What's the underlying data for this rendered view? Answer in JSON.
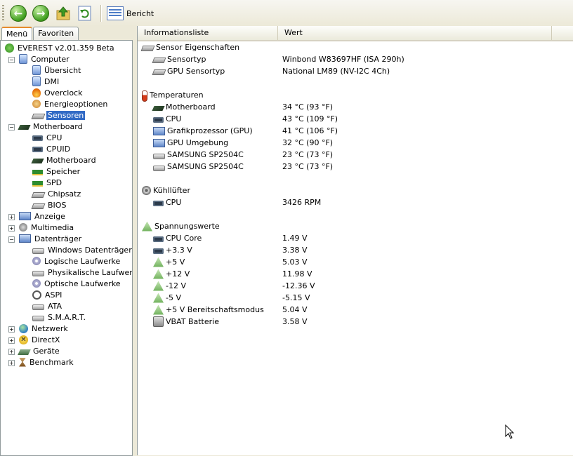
{
  "toolbar": {
    "report_label": "Bericht"
  },
  "tabs": [
    {
      "label": "Menü"
    },
    {
      "label": "Favoriten"
    }
  ],
  "tree": {
    "root": "EVEREST v2.01.359 Beta",
    "items": [
      {
        "label": "Computer"
      },
      {
        "label": "Übersicht"
      },
      {
        "label": "DMI"
      },
      {
        "label": "Overclock"
      },
      {
        "label": "Energieoptionen"
      },
      {
        "label": "Sensoren"
      },
      {
        "label": "Motherboard"
      },
      {
        "label": "CPU"
      },
      {
        "label": "CPUID"
      },
      {
        "label": "Motherboard"
      },
      {
        "label": "Speicher"
      },
      {
        "label": "SPD"
      },
      {
        "label": "Chipsatz"
      },
      {
        "label": "BIOS"
      },
      {
        "label": "Anzeige"
      },
      {
        "label": "Multimedia"
      },
      {
        "label": "Datenträger"
      },
      {
        "label": "Windows Datenträger"
      },
      {
        "label": "Logische Laufwerke"
      },
      {
        "label": "Physikalische Laufwerke"
      },
      {
        "label": "Optische Laufwerke"
      },
      {
        "label": "ASPI"
      },
      {
        "label": "ATA"
      },
      {
        "label": "S.M.A.R.T."
      },
      {
        "label": "Netzwerk"
      },
      {
        "label": "DirectX"
      },
      {
        "label": "Geräte"
      },
      {
        "label": "Benchmark"
      }
    ]
  },
  "list": {
    "columns": [
      "Informationsliste",
      "Wert"
    ],
    "groups": [
      {
        "title": "Sensor Eigenschaften",
        "rows": [
          {
            "label": "Sensortyp",
            "value": "Winbond W83697HF  (ISA 290h)"
          },
          {
            "label": "GPU Sensortyp",
            "value": "National LM89  (NV-I2C 4Ch)"
          }
        ]
      },
      {
        "title": "Temperaturen",
        "rows": [
          {
            "label": "Motherboard",
            "value": "34 °C  (93 °F)"
          },
          {
            "label": "CPU",
            "value": "43 °C  (109 °F)"
          },
          {
            "label": "Grafikprozessor (GPU)",
            "value": "41 °C  (106 °F)"
          },
          {
            "label": "GPU Umgebung",
            "value": "32 °C  (90 °F)"
          },
          {
            "label": "SAMSUNG SP2504C",
            "value": "23 °C  (73 °F)"
          },
          {
            "label": "SAMSUNG SP2504C",
            "value": "23 °C  (73 °F)"
          }
        ]
      },
      {
        "title": "Kühllüfter",
        "rows": [
          {
            "label": "CPU",
            "value": "3426 RPM"
          }
        ]
      },
      {
        "title": "Spannungswerte",
        "rows": [
          {
            "label": "CPU Core",
            "value": "1.49 V"
          },
          {
            "label": "+3.3 V",
            "value": "3.38 V"
          },
          {
            "label": "+5 V",
            "value": "5.03 V"
          },
          {
            "label": "+12 V",
            "value": "11.98 V"
          },
          {
            "label": "-12 V",
            "value": "-12.36 V"
          },
          {
            "label": "-5 V",
            "value": "-5.15 V"
          },
          {
            "label": "+5 V Bereitschaftsmodus",
            "value": "5.04 V"
          },
          {
            "label": "VBAT Batterie",
            "value": "3.58 V"
          }
        ]
      }
    ]
  }
}
